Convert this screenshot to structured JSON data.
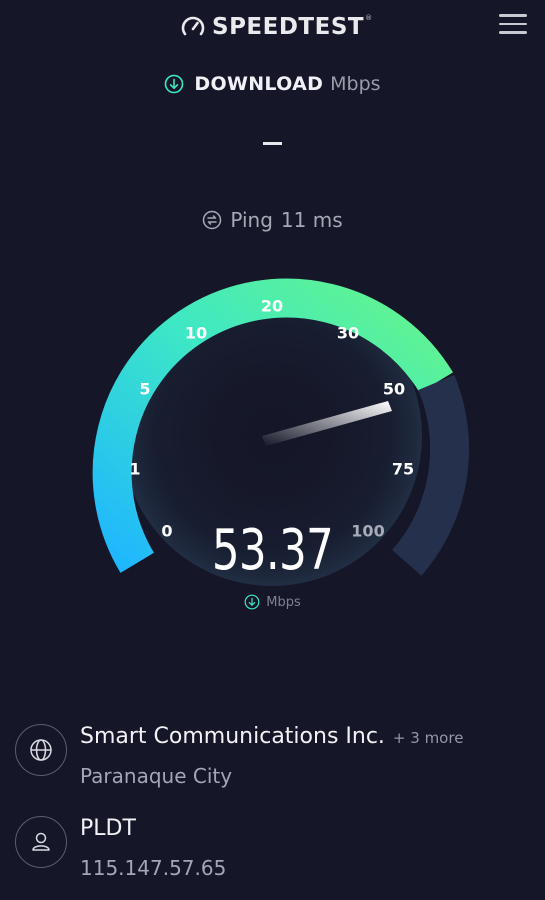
{
  "header": {
    "logo_text": "SPEEDTEST",
    "logo_tm": "®"
  },
  "download": {
    "label": "DOWNLOAD",
    "unit": "Mbps"
  },
  "ping": {
    "label": "Ping",
    "value": "11 ms"
  },
  "gauge": {
    "ticks": [
      "0",
      "1",
      "5",
      "10",
      "20",
      "30",
      "50",
      "75",
      "100"
    ],
    "speed_value": "53.37",
    "speed_unit": "Mbps",
    "colors": {
      "start": "#1fb6ff",
      "mid": "#3ee8c4",
      "end": "#66f58a",
      "inactive": "#25304d"
    }
  },
  "server": {
    "name": "Smart Communications Inc.",
    "more": "+ 3 more",
    "location": "Paranaque City",
    "icon": "globe-icon"
  },
  "provider": {
    "name": "PLDT",
    "ip": "115.147.57.65",
    "icon": "user-icon"
  }
}
